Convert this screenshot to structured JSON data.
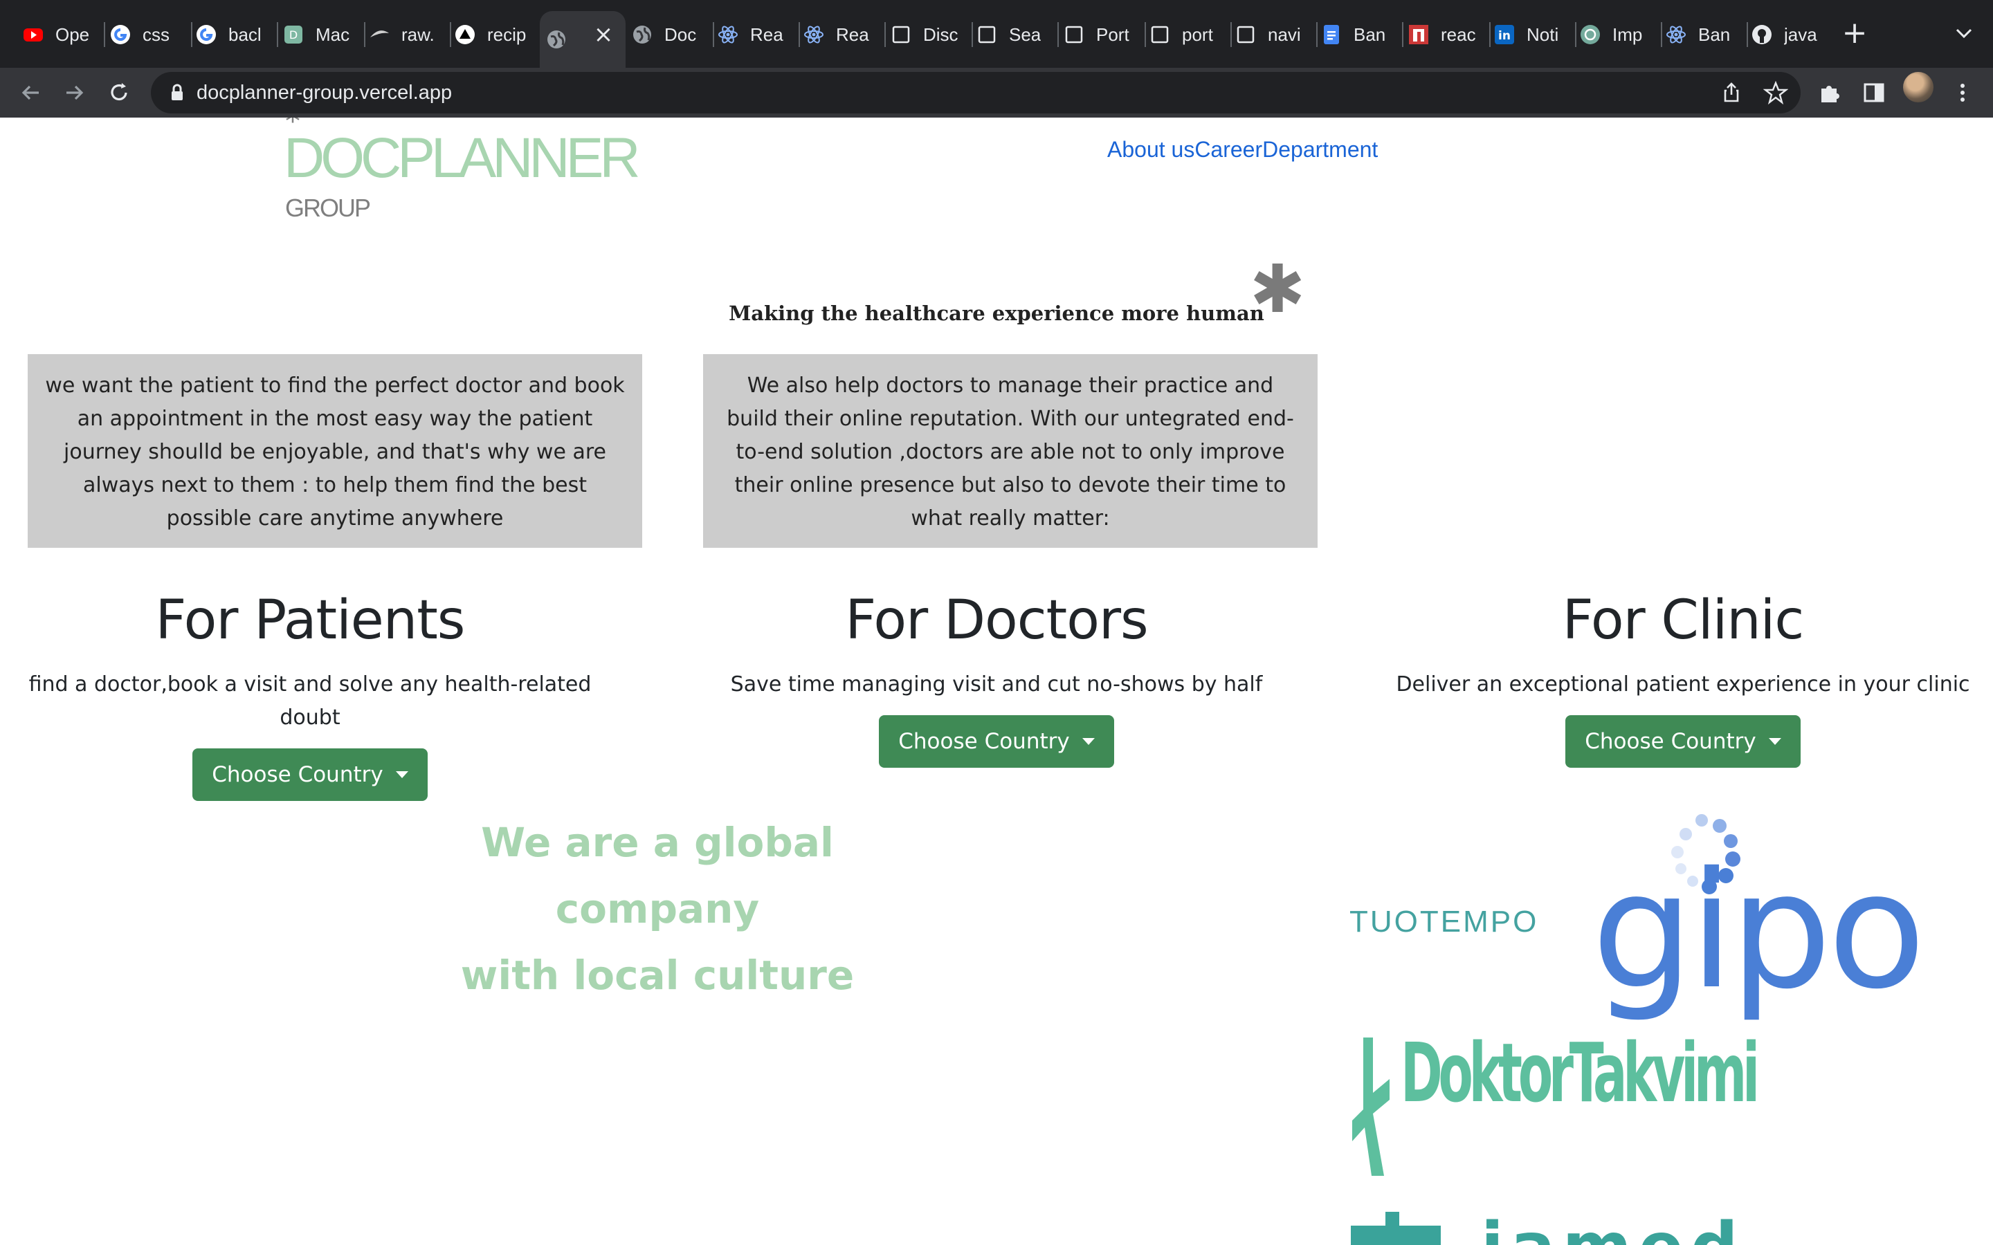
{
  "browser": {
    "tabs": [
      {
        "label": "Ope",
        "icon": "youtube-icon"
      },
      {
        "label": "css",
        "icon": "google-icon"
      },
      {
        "label": "bacl",
        "icon": "google-icon"
      },
      {
        "label": "Mac",
        "icon": "app-icon"
      },
      {
        "label": "raw.",
        "icon": "leaf-icon"
      },
      {
        "label": "recip",
        "icon": "triangle-icon"
      },
      {
        "label": "",
        "icon": "globe-icon",
        "active": true
      },
      {
        "label": "Doc",
        "icon": "globe-icon"
      },
      {
        "label": "Rea",
        "icon": "react-icon"
      },
      {
        "label": "Rea",
        "icon": "react-icon"
      },
      {
        "label": "Disc",
        "icon": "page-icon"
      },
      {
        "label": "Sea",
        "icon": "page-icon"
      },
      {
        "label": "Port",
        "icon": "page-icon"
      },
      {
        "label": "port",
        "icon": "page-icon"
      },
      {
        "label": "navi",
        "icon": "page-icon"
      },
      {
        "label": "Ban",
        "icon": "docs-icon"
      },
      {
        "label": "reac",
        "icon": "npm-icon"
      },
      {
        "label": "Noti",
        "icon": "linkedin-icon"
      },
      {
        "label": "Imp",
        "icon": "chatgpt-icon"
      },
      {
        "label": "Ban",
        "icon": "react-icon"
      },
      {
        "label": "java",
        "icon": "github-icon"
      }
    ],
    "url": "docplanner-group.vercel.app"
  },
  "header": {
    "logo_word": "DOCPLANNER",
    "logo_sub": "GROUP",
    "nav": [
      "About us",
      "Career",
      "Department"
    ]
  },
  "hero": {
    "tagline": "Making the healthcare experience more human"
  },
  "boxes": {
    "patient_text": "we want the patient to find the perfect doctor and book an appointment in the most easy way the patient journey shoulld be enjoyable, and that's why we are always next to them : to help them find the best possible care anytime anywhere",
    "doctor_text": "We also help doctors to manage their practice and build their online reputation. With our untegrated end-to-end solution ,doctors are able not to only improve their online presence but also to devote their time to what really matter:"
  },
  "columns": [
    {
      "title": "For Patients",
      "text": "find a doctor,book a visit and solve any health-related doubt",
      "button": "Choose Country"
    },
    {
      "title": "For Doctors",
      "text": "Save time managing visit and cut no-shows by half",
      "button": "Choose Country"
    },
    {
      "title": "For Clinic",
      "text": "Deliver an exceptional patient experience in your clinic",
      "button": "Choose Country"
    }
  ],
  "global": {
    "line1": "We are a global",
    "line2": "company",
    "line3": "with local culture"
  },
  "brands": {
    "tuotempo": "TUOTEMPO",
    "gipo": "gipo",
    "doktortakvimi": "DoktorTakvimi",
    "iamed": "iamed"
  },
  "colors": {
    "accent_green": "#3f8a55",
    "logo_green": "#a8d5b0",
    "link_blue": "#1a64d6",
    "box_gray": "#cccccc"
  }
}
